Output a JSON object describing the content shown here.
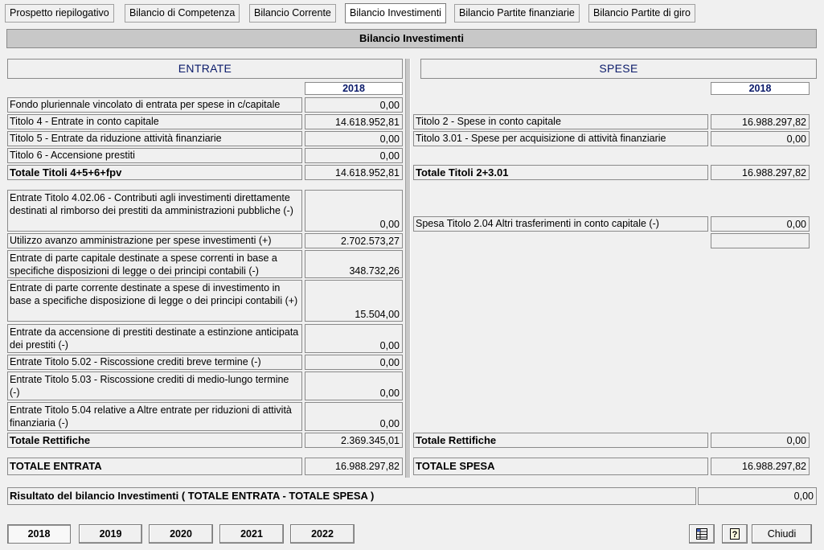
{
  "tabs": [
    "Prospetto riepilogativo",
    "Bilancio di Competenza",
    "Bilancio Corrente",
    "Bilancio Investimenti",
    "Bilancio Partite finanziarie",
    "Bilancio Partite di giro"
  ],
  "page_title": "Bilancio Investimenti",
  "entrate": {
    "header": "ENTRATE",
    "year": "2018",
    "rows": [
      {
        "label": "Fondo pluriennale vincolato di entrata per spese in c/capitale",
        "value": "0,00"
      },
      {
        "label": "Titolo 4 - Entrate in conto capitale",
        "value": "14.618.952,81"
      },
      {
        "label": "Titolo 5 - Entrate da riduzione attività finanziarie",
        "value": "0,00"
      },
      {
        "label": "Titolo 6 - Accensione prestiti",
        "value": "0,00"
      },
      {
        "label": "Totale Titoli 4+5+6+fpv",
        "value": "14.618.952,81"
      },
      {
        "label": "Entrate Titolo 4.02.06 - Contributi agli investimenti direttamente destinati al rimborso dei prestiti da amministrazioni pubbliche (-)",
        "value": "0,00"
      },
      {
        "label": "Utilizzo avanzo amministrazione per spese investimenti (+)",
        "value": "2.702.573,27"
      },
      {
        "label": "Entrate di parte capitale destinate a spese correnti in base a specifiche disposizioni di legge o dei principi contabili (-)",
        "value": "348.732,26"
      },
      {
        "label": "Entrate di parte corrente destinate a spese di investimento in base a specifiche disposizione di legge o dei principi contabili (+)",
        "value": "15.504,00"
      },
      {
        "label": "Entrate da accensione di prestiti destinate a estinzione anticipata dei prestiti (-)",
        "value": "0,00"
      },
      {
        "label": "Entrate Titolo 5.02 - Riscossione crediti breve termine (-)",
        "value": "0,00"
      },
      {
        "label": "Entrate Titolo 5.03 - Riscossione crediti di medio-lungo termine (-)",
        "value": "0,00"
      },
      {
        "label": "Entrate Titolo 5.04 relative a Altre entrate per riduzioni di attività finanziaria (-)",
        "value": "0,00"
      },
      {
        "label": "Totale Rettifiche",
        "value": "2.369.345,01"
      },
      {
        "label": "TOTALE ENTRATA",
        "value": "16.988.297,82"
      }
    ]
  },
  "spese": {
    "header": "SPESE",
    "year": "2018",
    "rows": [
      {
        "label": "Titolo 2 - Spese in conto capitale",
        "value": "16.988.297,82"
      },
      {
        "label": "Titolo 3.01 - Spese per acquisizione di attività finanziarie",
        "value": "0,00"
      },
      {
        "label": "Totale Titoli 2+3.01",
        "value": "16.988.297,82"
      },
      {
        "label": "Spesa Titolo 2.04 Altri trasferimenti in conto capitale (-)",
        "value": "0,00"
      },
      {
        "label": "",
        "value": ""
      },
      {
        "label": "Totale Rettifiche",
        "value": "0,00"
      },
      {
        "label": "TOTALE SPESA",
        "value": "16.988.297,82"
      }
    ]
  },
  "risultato": {
    "label": "Risultato del bilancio Investimenti ( TOTALE ENTRATA - TOTALE SPESA )",
    "value": "0,00"
  },
  "years": [
    "2018",
    "2019",
    "2020",
    "2021",
    "2022"
  ],
  "footer": {
    "close_label": "Chiudi",
    "icons": [
      "table-icon",
      "help-icon"
    ]
  }
}
